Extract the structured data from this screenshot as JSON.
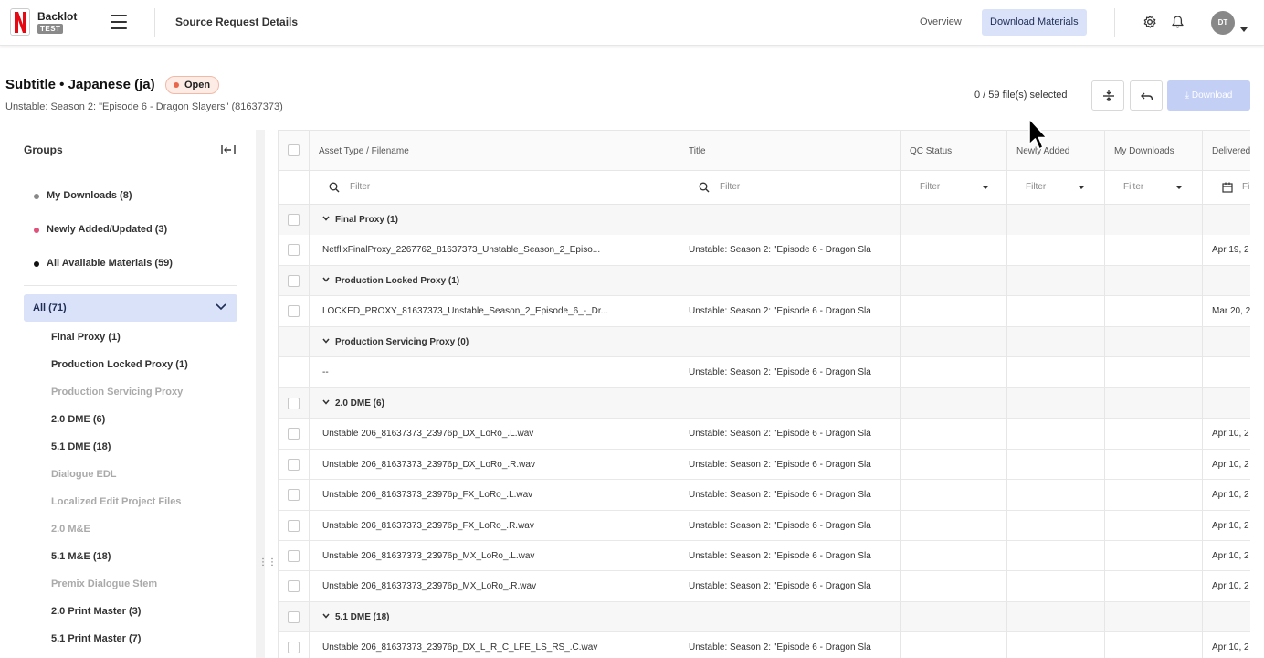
{
  "app": {
    "brand": "Backlot",
    "badge": "TEST",
    "page_name": "Source Request Details",
    "tabs": [
      {
        "label": "Overview"
      },
      {
        "label": "Download Materials"
      }
    ],
    "avatar_initials": "DT"
  },
  "header": {
    "title": "Subtitle • Japanese (ja)",
    "status": "Open",
    "subtitle": "Unstable: Season 2: \"Episode 6 - Dragon Slayers\" (81637373)",
    "selected_text": "0 / 59 file(s) selected",
    "download_label": "Download"
  },
  "sidebar": {
    "title": "Groups",
    "groups": [
      {
        "label": "My Downloads (8)",
        "color": "#888888"
      },
      {
        "label": "Newly Added/Updated (3)",
        "color": "#e0507a"
      },
      {
        "label": "All Available Materials (59)",
        "color": "#111111"
      }
    ],
    "all_label": "All (71)",
    "items": [
      {
        "label": "Final Proxy (1)",
        "dim": false
      },
      {
        "label": "Production Locked Proxy (1)",
        "dim": false
      },
      {
        "label": "Production Servicing Proxy",
        "dim": true
      },
      {
        "label": "2.0 DME (6)",
        "dim": false
      },
      {
        "label": "5.1 DME (18)",
        "dim": false
      },
      {
        "label": "Dialogue EDL",
        "dim": true
      },
      {
        "label": "Localized Edit Project Files",
        "dim": true
      },
      {
        "label": "2.0 M&E",
        "dim": true
      },
      {
        "label": "5.1 M&E (18)",
        "dim": false
      },
      {
        "label": "Premix Dialogue Stem",
        "dim": true
      },
      {
        "label": "2.0 Print Master (3)",
        "dim": false
      },
      {
        "label": "5.1 Print Master (7)",
        "dim": false
      }
    ]
  },
  "table": {
    "columns": [
      "Asset Type / Filename",
      "Title",
      "QC Status",
      "Newly Added",
      "My Downloads",
      "Delivered"
    ],
    "filter_placeholder": "Filter",
    "rows": [
      {
        "type": "group",
        "name": "Final Proxy (1)"
      },
      {
        "type": "file",
        "name": "NetflixFinalProxy_2267762_81637373_Unstable_Season_2_Episo...",
        "title": "Unstable: Season 2: \"Episode 6 - Dragon Sla",
        "delivered": "Apr 19, 2"
      },
      {
        "type": "group",
        "name": "Production Locked Proxy (1)"
      },
      {
        "type": "file",
        "name": "LOCKED_PROXY_81637373_Unstable_Season_2_Episode_6_-_Dr...",
        "title": "Unstable: Season 2: \"Episode 6 - Dragon Sla",
        "delivered": "Mar 20, 2"
      },
      {
        "type": "group",
        "name": "Production Servicing Proxy (0)",
        "nocheck": true
      },
      {
        "type": "file",
        "name": "--",
        "title": "Unstable: Season 2: \"Episode 6 - Dragon Sla",
        "delivered": "",
        "nocheck": true
      },
      {
        "type": "group",
        "name": "2.0 DME (6)"
      },
      {
        "type": "file",
        "name": "Unstable 206_81637373_23976p_DX_LoRo_.L.wav",
        "title": "Unstable: Season 2: \"Episode 6 - Dragon Sla",
        "delivered": "Apr 10, 2"
      },
      {
        "type": "file",
        "name": "Unstable 206_81637373_23976p_DX_LoRo_.R.wav",
        "title": "Unstable: Season 2: \"Episode 6 - Dragon Sla",
        "delivered": "Apr 10, 2"
      },
      {
        "type": "file",
        "name": "Unstable 206_81637373_23976p_FX_LoRo_.L.wav",
        "title": "Unstable: Season 2: \"Episode 6 - Dragon Sla",
        "delivered": "Apr 10, 2"
      },
      {
        "type": "file",
        "name": "Unstable 206_81637373_23976p_FX_LoRo_.R.wav",
        "title": "Unstable: Season 2: \"Episode 6 - Dragon Sla",
        "delivered": "Apr 10, 2"
      },
      {
        "type": "file",
        "name": "Unstable 206_81637373_23976p_MX_LoRo_.L.wav",
        "title": "Unstable: Season 2: \"Episode 6 - Dragon Sla",
        "delivered": "Apr 10, 2"
      },
      {
        "type": "file",
        "name": "Unstable 206_81637373_23976p_MX_LoRo_.R.wav",
        "title": "Unstable: Season 2: \"Episode 6 - Dragon Sla",
        "delivered": "Apr 10, 2"
      },
      {
        "type": "group",
        "name": "5.1 DME (18)"
      },
      {
        "type": "file",
        "name": "Unstable 206_81637373_23976p_DX_L_R_C_LFE_LS_RS_.C.wav",
        "title": "Unstable: Season 2: \"Episode 6 - Dragon Sla",
        "delivered": "Apr 10, 2"
      }
    ]
  },
  "colors": {
    "accent": "#d9e2f9",
    "download_disabled": "#c3cff5",
    "status_open": "#e8674b",
    "netflix_red": "#e50914"
  }
}
